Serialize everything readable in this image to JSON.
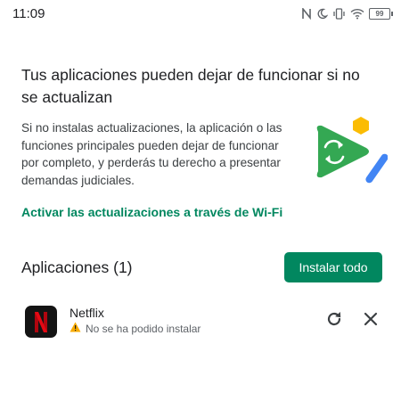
{
  "status_bar": {
    "time": "11:09",
    "battery": "99",
    "icons": [
      "nfc-icon",
      "do-not-disturb-icon",
      "vibrate-icon",
      "wifi-icon",
      "battery-icon"
    ]
  },
  "header": {
    "title": "Tus aplicaciones pueden dejar de funcionar si no se actualizan",
    "description": "Si no instalas actualizaciones, la aplicación o las funciones principales pueden dejar de funcionar por completo, y perderás tu derecho a presentar demandas judiciales.",
    "wifi_link": "Activar las actualizaciones a través de Wi-Fi"
  },
  "apps": {
    "heading": "Aplicaciones (1)",
    "install_all_label": "Instalar todo",
    "items": [
      {
        "name": "Netflix",
        "status": "No se ha podido instalar",
        "icon": "netflix-icon"
      }
    ]
  },
  "colors": {
    "accent": "#01875f",
    "warning": "#f9ab00",
    "netflix_red": "#e50914"
  }
}
